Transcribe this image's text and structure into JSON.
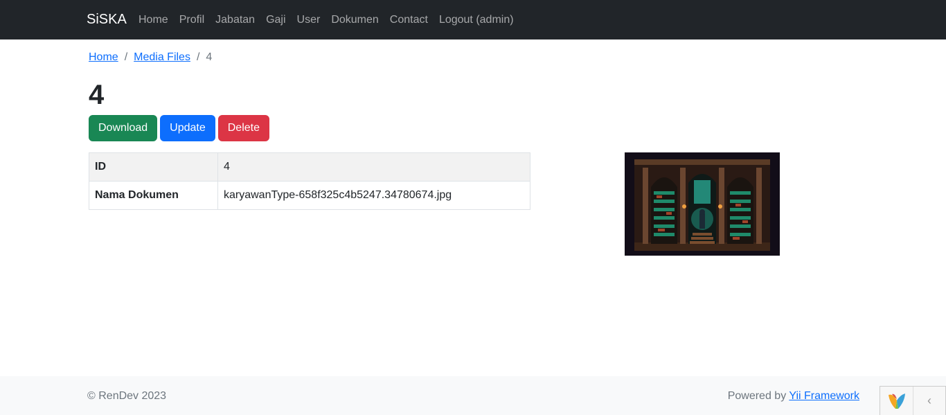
{
  "nav": {
    "brand": "SiSKA",
    "items": [
      "Home",
      "Profil",
      "Jabatan",
      "Gaji",
      "User",
      "Dokumen",
      "Contact",
      "Logout (admin)"
    ]
  },
  "breadcrumb": {
    "home": "Home",
    "media": "Media Files",
    "current": "4"
  },
  "title": "4",
  "buttons": {
    "download": "Download",
    "update": "Update",
    "delete": "Delete"
  },
  "detail": {
    "rows": [
      {
        "label": "ID",
        "value": "4"
      },
      {
        "label": "Nama Dokumen",
        "value": "karyawanType-658f325c4b5247.34780674.jpg"
      }
    ]
  },
  "footer": {
    "copyright": "© RenDev 2023",
    "powered_prefix": "Powered by",
    "powered_link": "Yii Framework"
  },
  "debug": {
    "logo_icon": "yii-logo-icon",
    "toggle_icon": "chevron-left-icon"
  },
  "colors": {
    "navbar": "#212529",
    "success": "#198754",
    "primary": "#0d6efd",
    "danger": "#dc3545"
  }
}
